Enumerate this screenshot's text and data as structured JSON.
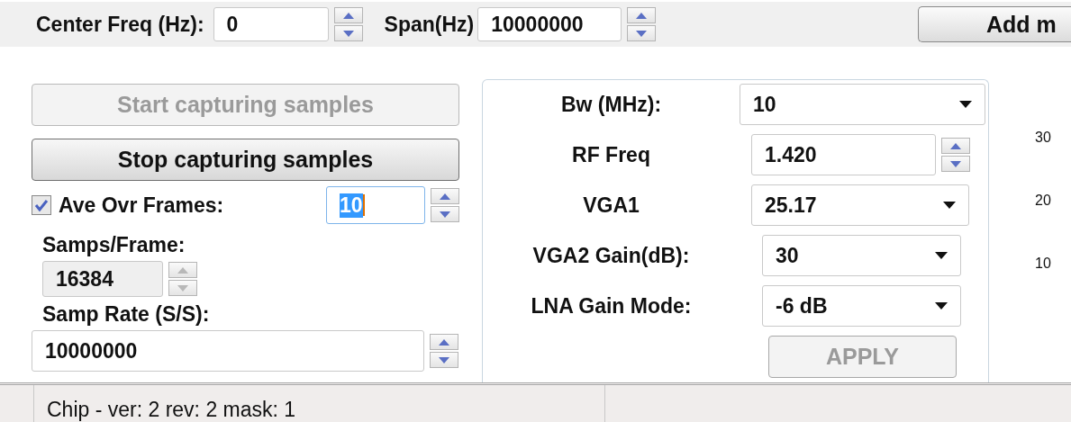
{
  "toolbar": {
    "center_freq": {
      "label": "Center Freq (Hz):",
      "value": "0"
    },
    "span": {
      "label": "Span(Hz)",
      "value": "10000000"
    },
    "add_button": {
      "label": "Add m"
    }
  },
  "capture": {
    "buttons": [
      {
        "label": "Start capturing samples",
        "disabled": true
      },
      {
        "label": "Stop capturing samples",
        "disabled": false
      }
    ],
    "average": {
      "label": "Ave Ovr Frames:",
      "checked": true,
      "value": "10",
      "text_selected": true
    },
    "samps_per_frame": {
      "label": "Samps/Frame:",
      "value": "16384",
      "disabled": true
    },
    "samp_rate": {
      "label": "Samp Rate (S/S):",
      "value": "10000000"
    }
  },
  "radio": {
    "rows": [
      {
        "kind": "dropdown",
        "label": "Bw (MHz):",
        "value": "10"
      },
      {
        "kind": "spinbox",
        "label": "RF Freq",
        "value": "1.420"
      },
      {
        "kind": "dropdown",
        "label": "VGA1",
        "value": "25.17"
      },
      {
        "kind": "dropdown",
        "label": "VGA2 Gain(dB):",
        "value": "30"
      },
      {
        "kind": "dropdown",
        "label": "LNA Gain Mode:",
        "value": "-6 dB"
      }
    ],
    "apply": {
      "label": "APPLY",
      "disabled": true
    }
  },
  "axis_ticks": [
    "30",
    "20",
    "10"
  ],
  "status_bar": {
    "text": "Chip - ver: 2 rev: 2 mask: 1"
  }
}
